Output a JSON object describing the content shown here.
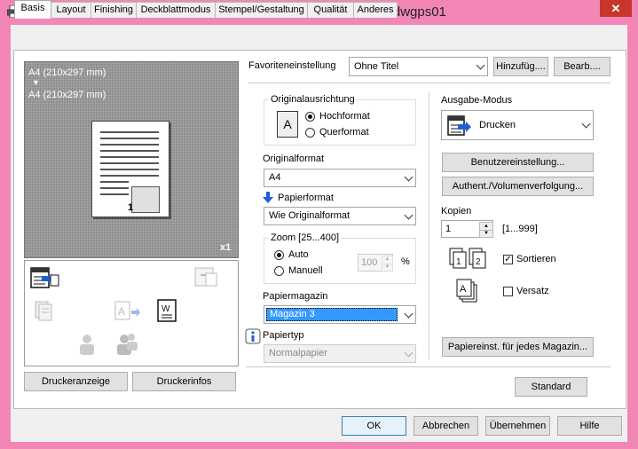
{
  "window": {
    "title": "Standardwerte für PRN-EK-04 an dwgps01",
    "close_glyph": "✕"
  },
  "tabs": [
    {
      "label": "Basis"
    },
    {
      "label": "Layout"
    },
    {
      "label": "Finishing"
    },
    {
      "label": "Deckblattmodus"
    },
    {
      "label": "Stempel/Gestaltung"
    },
    {
      "label": "Qualität"
    },
    {
      "label": "Anderes"
    }
  ],
  "preview": {
    "line1": "A4 (210x297 mm)",
    "arrow": "▼",
    "line2": "A4 (210x297 mm)",
    "page_number": "1",
    "copies_badge": "x1"
  },
  "printer_buttons": {
    "display": "Druckeranzeige",
    "info": "Druckerinfos"
  },
  "favorites": {
    "label": "Favoriteneinstellung",
    "value": "Ohne Titel",
    "add": "Hinzufüg....",
    "edit": "Bearb...."
  },
  "orientation": {
    "label": "Originalausrichtung",
    "portrait": "Hochformat",
    "landscape": "Querformat",
    "icon_letter": "A"
  },
  "original_format": {
    "label": "Originalformat",
    "value": "A4"
  },
  "paper_format": {
    "label": "Papierformat",
    "value": "Wie Originalformat"
  },
  "zoom": {
    "label": "Zoom [25...400]",
    "auto": "Auto",
    "manual": "Manuell",
    "value": "100",
    "unit": "%"
  },
  "paper_tray": {
    "label": "Papiermagazin",
    "value": "Magazin 3"
  },
  "paper_type": {
    "label": "Papiertyp",
    "value": "Normalpapier"
  },
  "output": {
    "label": "Ausgabe-Modus",
    "value": "Drucken"
  },
  "user_settings": "Benutzereinstellung...",
  "auth": "Authent./Volumenverfolgung...",
  "copies": {
    "label": "Kopien",
    "value": "1",
    "range": "[1...999]",
    "sort_label": "Sortieren",
    "staple_label": "Versatz"
  },
  "paper_per_tray": "Papiereinst. für jedes Magazin...",
  "standard": "Standard",
  "footer": {
    "ok": "OK",
    "cancel": "Abbrechen",
    "apply": "Übernehmen",
    "help": "Hilfe"
  },
  "colors": {
    "titlebar": "#f287b7",
    "selection": "#3399ff",
    "close": "#c7352b",
    "accent_arrow": "#1f5fd6"
  }
}
